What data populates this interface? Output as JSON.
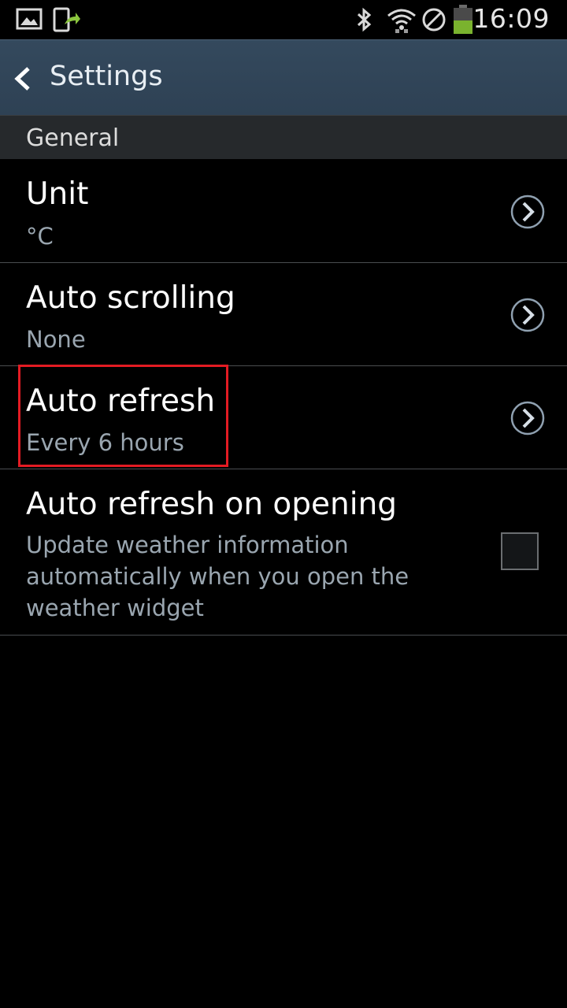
{
  "status_bar": {
    "time": "16:09",
    "left_icons": [
      "image-notification-icon",
      "phone-update-icon"
    ],
    "right_icons": [
      "bluetooth-icon",
      "wifi-icon",
      "do-not-disturb-icon",
      "battery-icon"
    ],
    "battery_color": "#7ab32e"
  },
  "action_bar": {
    "title": "Settings",
    "back_icon": "chevron-left-icon"
  },
  "section": {
    "title": "General"
  },
  "settings": [
    {
      "title": "Unit",
      "summary": "°C",
      "control": "chevron-right-icon"
    },
    {
      "title": "Auto scrolling",
      "summary": "None",
      "control": "chevron-right-icon"
    },
    {
      "title": "Auto refresh",
      "summary": "Every 6 hours",
      "control": "chevron-right-icon",
      "highlighted": true
    },
    {
      "title": "Auto refresh on opening",
      "summary": "Update weather information automatically when you open the weather widget",
      "control": "checkbox",
      "checked": false
    }
  ],
  "colors": {
    "background": "#000000",
    "action_bar": "#2f4255",
    "section_header": "#26292c",
    "summary_text": "#9aa6b0",
    "highlight_box": "#e31b23"
  }
}
